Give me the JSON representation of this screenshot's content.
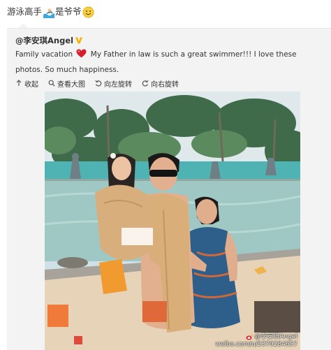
{
  "header": {
    "text_part1": "游泳高手",
    "text_part2": "是爷爷",
    "emoji_1": "swimming-emoji-icon",
    "emoji_2": "smile-emoji-icon"
  },
  "post": {
    "author": "@李安琪Angel",
    "verified_icon": "verified-v-badge-icon",
    "text_before_heart": "Family vacation",
    "heart_icon": "red-heart-icon",
    "text_after_heart": "My Father in law is such a great swimmer!!! I love these photos. So much happiness.",
    "toolbar": {
      "collapse": "收起",
      "view_large": "查看大图",
      "rotate_left": "向左旋转",
      "rotate_right": "向右旋转"
    },
    "photo": {
      "watermark_name": "@李安琪Angel",
      "watermark_url": "weibo.com/u/5370284657"
    }
  },
  "colors": {
    "heart": "#d61f2b",
    "verified": "#f4b100",
    "watermark": "#ffffff"
  }
}
